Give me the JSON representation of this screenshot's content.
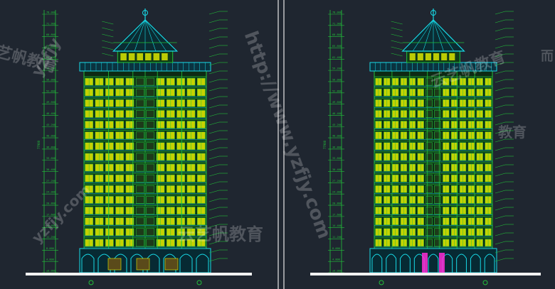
{
  "colors": {
    "background": "#1f2630",
    "divider": "#e8e8e8",
    "green_lines": "#22c23a",
    "yellow_windows": "#e6f000",
    "cyan_details": "#18d9e6",
    "white_ground": "#f2f2f2",
    "magenta": "#ff2bd6"
  },
  "left_elevation": {
    "dimension_labels": [
      "78.000",
      "71.900",
      "68.800",
      "65.600",
      "62.400",
      "59.200",
      "56.000",
      "52.800",
      "49.600",
      "46.400",
      "43.200",
      "40.000",
      "36.800",
      "33.600",
      "30.400",
      "27.200",
      "24.000",
      "20.800",
      "17.600",
      "14.400",
      "11.200",
      "8.000",
      "4.800",
      "±0.000"
    ],
    "total_height_label": "77900"
  },
  "right_elevation": {
    "dimension_labels": [
      "78.000",
      "71.900",
      "68.800",
      "65.600",
      "62.400",
      "59.200",
      "56.000",
      "52.800",
      "49.600",
      "46.400",
      "43.200",
      "40.000",
      "36.800",
      "33.600",
      "30.400",
      "27.200",
      "24.000",
      "20.800",
      "17.600",
      "14.400",
      "11.200",
      "8.000",
      "4.800",
      "±0.000"
    ],
    "total_height_label": "77900"
  },
  "watermarks": [
    {
      "text": "yzfjy",
      "size": 22,
      "angle": -60
    },
    {
      "text": "http://www.yzfjy.com",
      "size": 26,
      "angle": 70
    },
    {
      "text": "云艺帆教育",
      "size": 24,
      "angle": 0
    },
    {
      "text": "艺帆教育",
      "size": 22,
      "angle": 15
    },
    {
      "text": "yzfjy.com",
      "size": 20,
      "angle": -45
    },
    {
      "text": "云艺帆教育",
      "size": 22,
      "angle": -20
    },
    {
      "text": "教育",
      "size": 20,
      "angle": 0
    },
    {
      "text": "而",
      "size": 18,
      "angle": 0
    }
  ]
}
